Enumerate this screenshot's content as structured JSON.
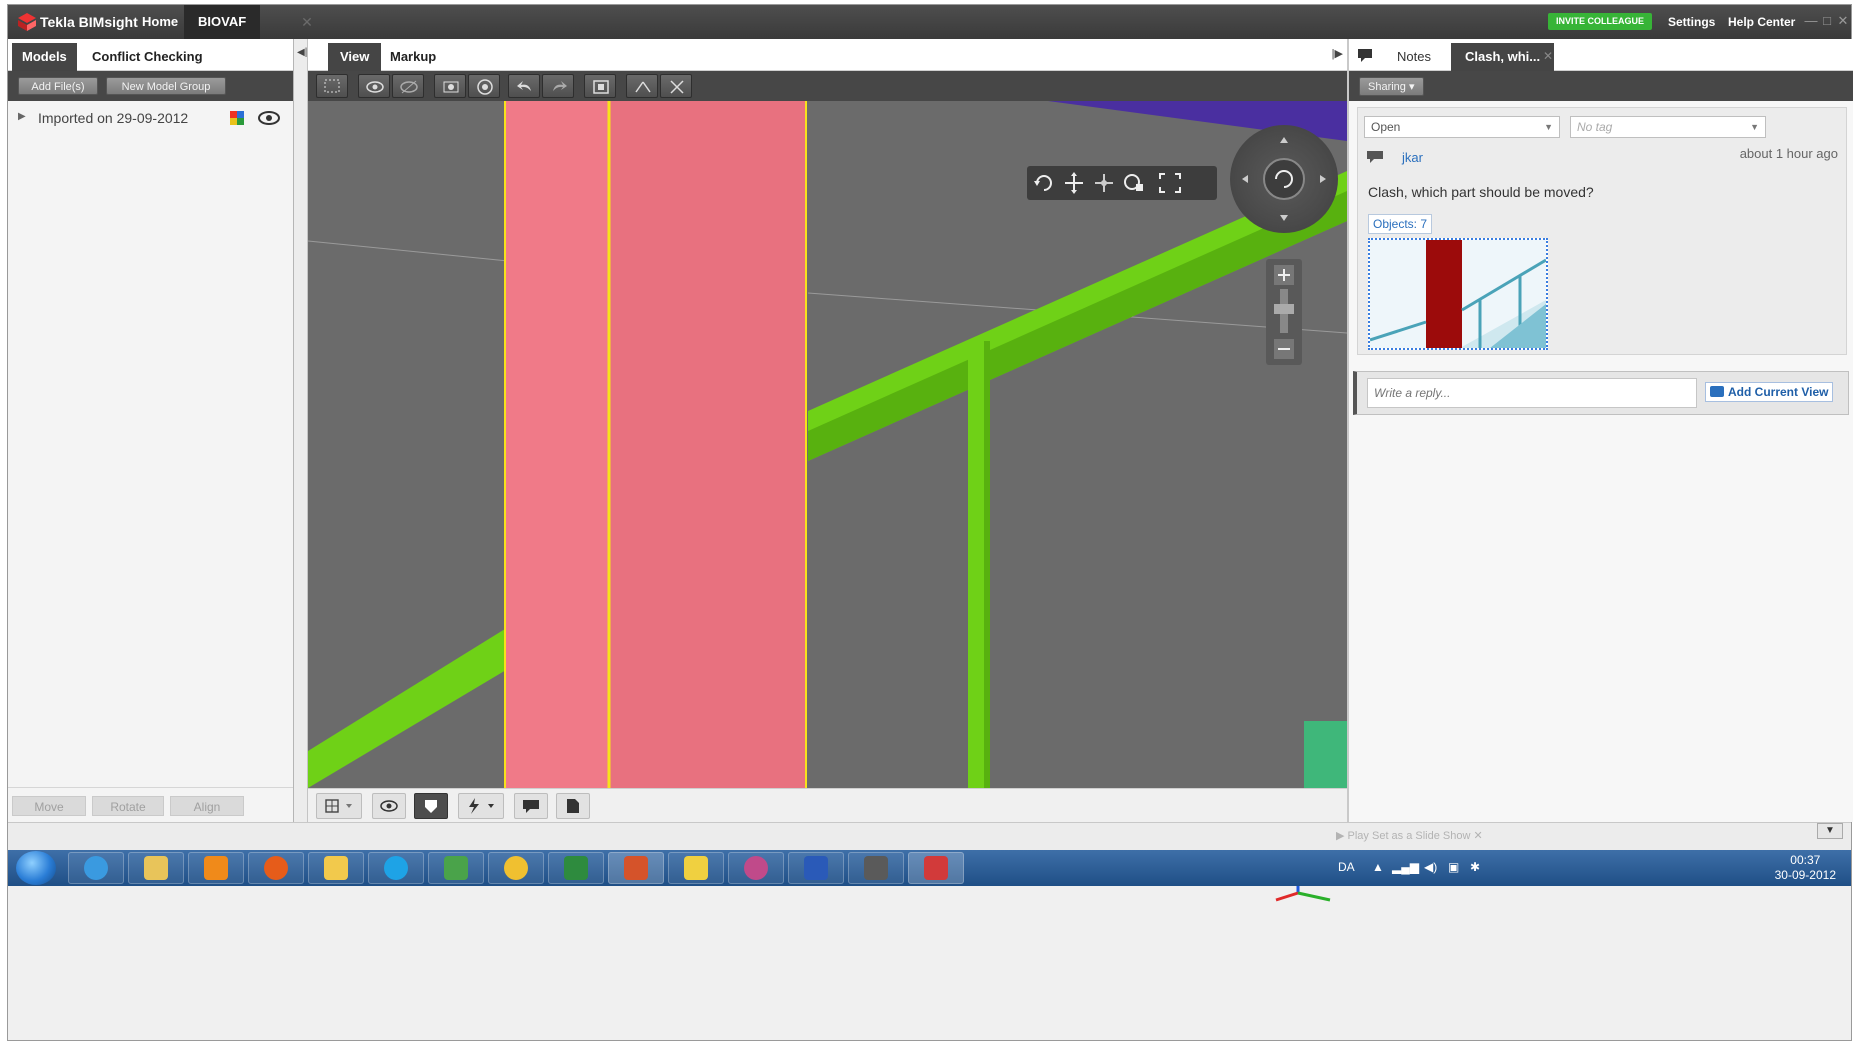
{
  "app": {
    "name": "Tekla BIMsight",
    "nav_home": "Home",
    "nav_project": "BIOVAF",
    "invite": "INVITE COLLEAGUE",
    "settings": "Settings",
    "help": "Help Center"
  },
  "left": {
    "tab_models": "Models",
    "tab_conflict": "Conflict Checking",
    "add_files": "Add File(s)",
    "new_group": "New Model Group",
    "tree_item": "Imported on 29-09-2012",
    "move": "Move",
    "rotate": "Rotate",
    "align": "Align"
  },
  "viewer": {
    "tab_view": "View",
    "tab_markup": "Markup"
  },
  "right": {
    "tab_notes": "Notes",
    "tab_clash": "Clash, whi...",
    "sharing": "Sharing",
    "status_value": "Open",
    "tag_placeholder": "No tag",
    "author": "jkar",
    "time": "about 1 hour ago",
    "note_text": "Clash, which part should be moved?",
    "objects": "Objects: 7",
    "reply_placeholder": "Write a reply...",
    "add_view": "Add Current View"
  },
  "status": {
    "slideshow": "Play Set as a Slide Show"
  },
  "tray": {
    "lang": "DA",
    "time": "00:37",
    "date": "30-09-2012"
  },
  "colors": {
    "accent_green": "#37b437",
    "pink_column": "#e8717f",
    "rail_green": "#6fd117",
    "link_blue": "#2a6fbd"
  }
}
